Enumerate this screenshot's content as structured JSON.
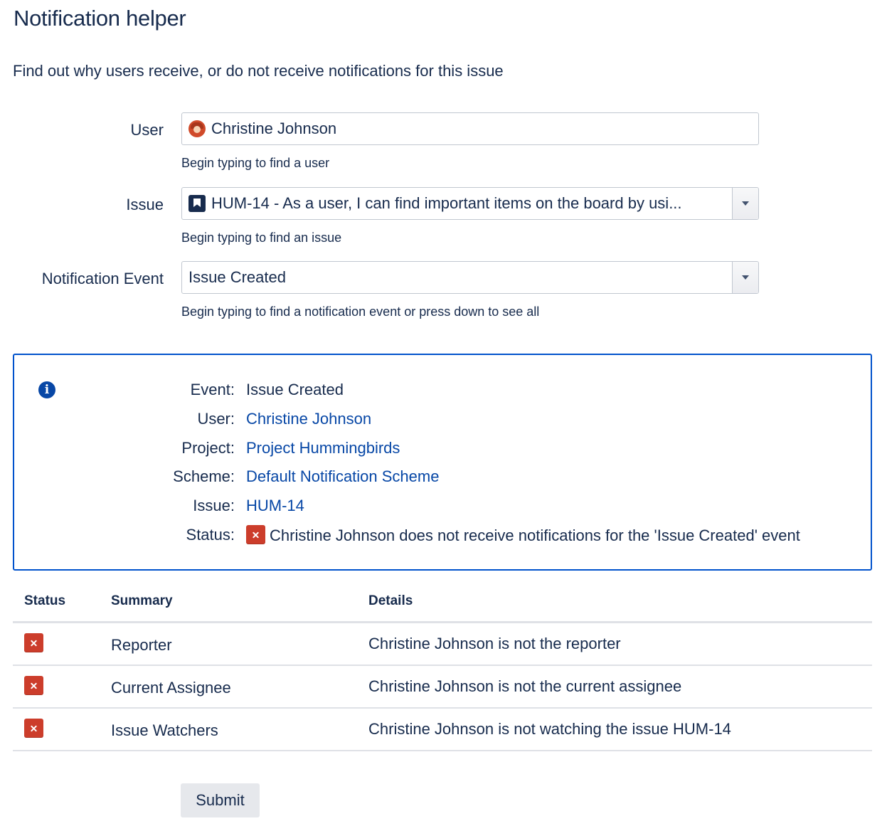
{
  "page": {
    "title": "Notification helper",
    "description": "Find out why users receive, or do not receive notifications for this issue"
  },
  "form": {
    "user": {
      "label": "User",
      "value": "Christine Johnson",
      "help": "Begin typing to find a user",
      "icon": "user-avatar-icon"
    },
    "issue": {
      "label": "Issue",
      "value": "HUM-14 - As a user, I can find important items on the board by usi...",
      "help": "Begin typing to find an issue",
      "icon": "story-bookmark-icon"
    },
    "event": {
      "label": "Notification Event",
      "value": "Issue Created",
      "help": "Begin typing to find a notification event or press down to see all"
    }
  },
  "info": {
    "icon": "info-icon",
    "rows": [
      {
        "key": "Event:",
        "value": "Issue Created"
      },
      {
        "key": "User:",
        "value": "Christine Johnson"
      },
      {
        "key": "Project:",
        "value": "Project Hummingbirds"
      },
      {
        "key": "Scheme:",
        "value": "Default Notification Scheme"
      },
      {
        "key": "Issue:",
        "value": "HUM-14"
      },
      {
        "key": "Status:",
        "value": "Christine Johnson does not receive notifications for the 'Issue Created' event"
      }
    ]
  },
  "table": {
    "headers": {
      "status": "Status",
      "summary": "Summary",
      "details": "Details"
    },
    "rows": [
      {
        "status": "error",
        "summary": "Reporter",
        "details": "Christine Johnson is not the reporter"
      },
      {
        "status": "error",
        "summary": "Current Assignee",
        "details": "Christine Johnson is not the current assignee"
      },
      {
        "status": "error",
        "summary": "Issue Watchers",
        "details": "Christine Johnson is not watching the issue HUM-14"
      }
    ]
  },
  "actions": {
    "submit_label": "Submit"
  },
  "colors": {
    "text": "#172b4d",
    "link": "#0747a6",
    "panel_border": "#0052cc",
    "error": "#cc3d2b",
    "button_bg": "#e6e8ec"
  }
}
